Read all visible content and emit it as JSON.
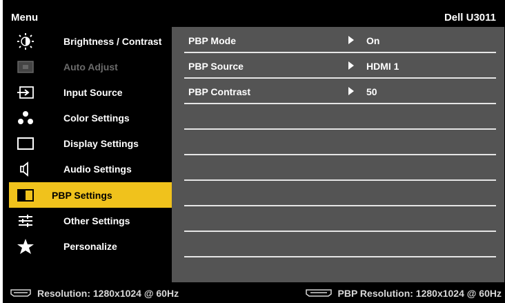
{
  "header": {
    "title": "Menu",
    "model": "Dell U3011"
  },
  "sidebar": {
    "items": [
      {
        "label": "Brightness / Contrast",
        "icon": "brightness-icon",
        "state": "normal"
      },
      {
        "label": "Auto Adjust",
        "icon": "auto-adjust-icon",
        "state": "disabled"
      },
      {
        "label": "Input Source",
        "icon": "input-source-icon",
        "state": "normal"
      },
      {
        "label": "Color Settings",
        "icon": "color-settings-icon",
        "state": "normal"
      },
      {
        "label": "Display Settings",
        "icon": "display-settings-icon",
        "state": "normal"
      },
      {
        "label": "Audio Settings",
        "icon": "audio-settings-icon",
        "state": "normal"
      },
      {
        "label": "PBP Settings",
        "icon": "pbp-settings-icon",
        "state": "selected"
      },
      {
        "label": "Other Settings",
        "icon": "other-settings-icon",
        "state": "normal"
      },
      {
        "label": "Personalize",
        "icon": "star-icon",
        "state": "normal"
      }
    ]
  },
  "main": {
    "rows": [
      {
        "name": "PBP Mode",
        "value": "On"
      },
      {
        "name": "PBP Source",
        "value": "HDMI 1"
      },
      {
        "name": "PBP Contrast",
        "value": "50"
      },
      {
        "name": "",
        "value": ""
      },
      {
        "name": "",
        "value": ""
      },
      {
        "name": "",
        "value": ""
      },
      {
        "name": "",
        "value": ""
      },
      {
        "name": "",
        "value": ""
      },
      {
        "name": "",
        "value": ""
      },
      {
        "name": "",
        "value": ""
      }
    ]
  },
  "status": {
    "resolution": "Resolution: 1280x1024 @ 60Hz",
    "pbp_resolution": "PBP Resolution: 1280x1024 @ 60Hz"
  },
  "colors": {
    "highlight": "#f0c21c",
    "panel": "#545454",
    "background": "#000000"
  }
}
